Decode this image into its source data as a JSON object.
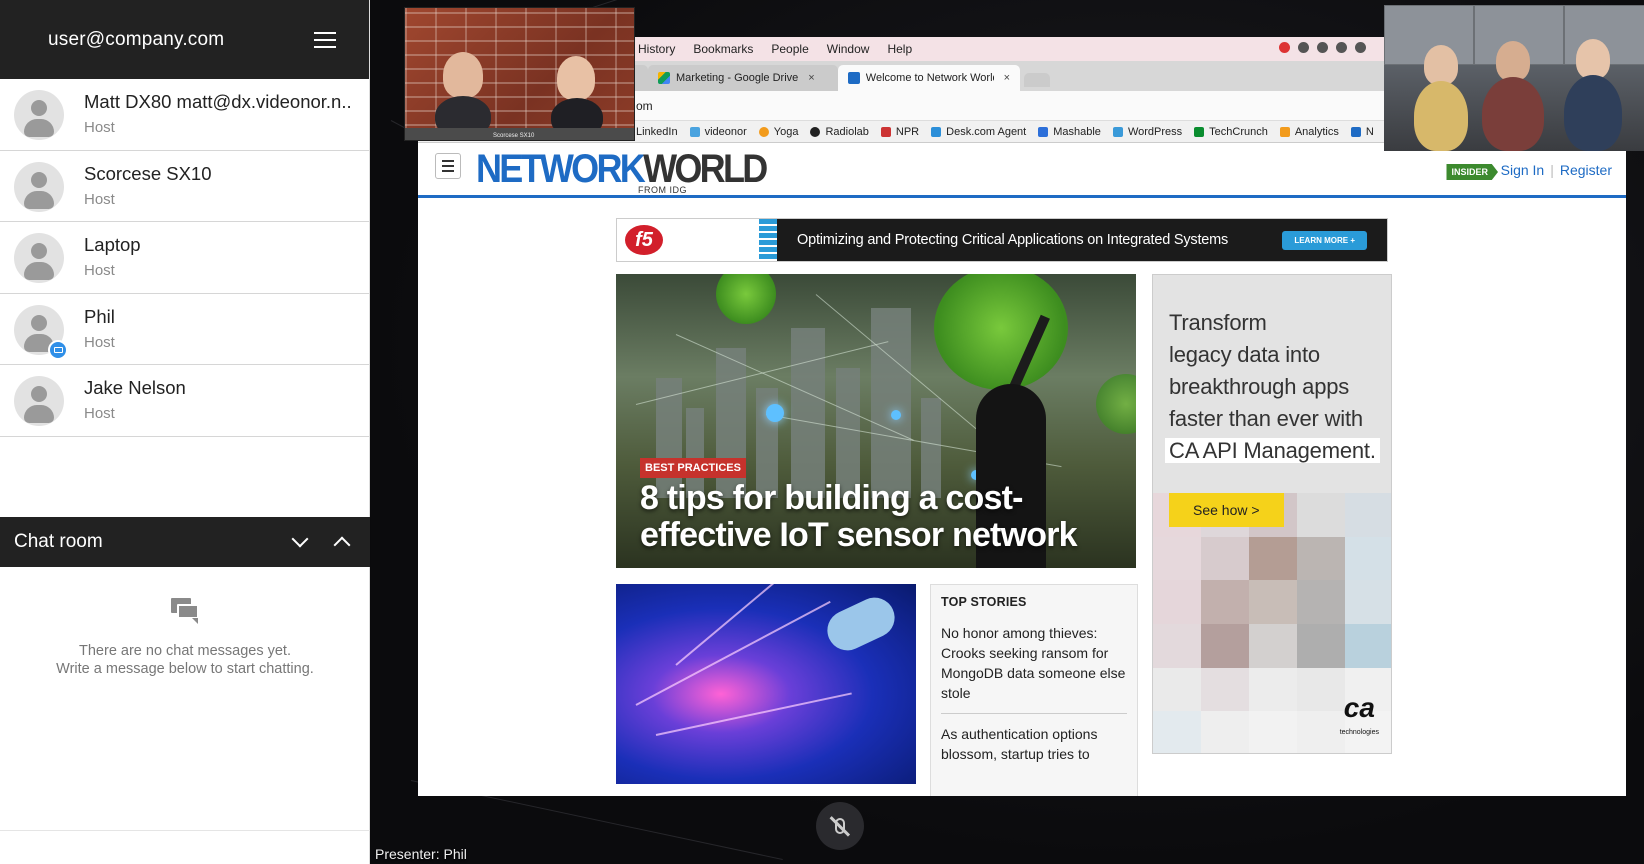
{
  "sidebar": {
    "user_email": "user@company.com",
    "participants": [
      {
        "name": "Matt DX80 matt@dx.videonor.n..",
        "role": "Host",
        "sharing": false
      },
      {
        "name": "Scorcese SX10",
        "role": "Host",
        "sharing": false
      },
      {
        "name": "Laptop",
        "role": "Host",
        "sharing": false
      },
      {
        "name": "Phil",
        "role": "Host",
        "sharing": true
      },
      {
        "name": "Jake Nelson",
        "role": "Host",
        "sharing": false
      }
    ],
    "chat": {
      "title": "Chat room",
      "empty_line1": "There are no chat messages yet.",
      "empty_line2": "Write a message below to start chatting."
    }
  },
  "stage": {
    "presenter_label": "Presenter: Phil",
    "video_tile_label": "Scorcese SX10",
    "mic_state": "muted"
  },
  "browser": {
    "menu": [
      "History",
      "Bookmarks",
      "People",
      "Window",
      "Help"
    ],
    "tabs": [
      {
        "label": "",
        "close": "×"
      },
      {
        "label": "Marketing - Google Drive",
        "close": "×"
      },
      {
        "label": "Welcome to Network World.cc",
        "close": "×"
      }
    ],
    "address_fragment": "om",
    "bookmarks": [
      "LinkedIn",
      "videonor",
      "Yoga",
      "Radiolab",
      "NPR",
      "Desk.com Agent",
      "Mashable",
      "WordPress",
      "TechCrunch",
      "Analytics",
      "N"
    ]
  },
  "website": {
    "logo_network": "NETWORK",
    "logo_world": "WORLD",
    "logo_from": "FROM IDG",
    "insider_badge": "INSIDER",
    "sign_in": "Sign In",
    "register": "Register",
    "banner": {
      "brand": "f5",
      "text": "Optimizing and Protecting Critical Applications on Integrated Systems",
      "cta": "LEARN MORE +"
    },
    "hero": {
      "tag": "BEST PRACTICES",
      "title": "8 tips for building a cost-effective IoT sensor network"
    },
    "side_ad": {
      "line1": "Transform",
      "line2": "legacy data into",
      "line3": "breakthrough apps",
      "line4": "faster than ever with",
      "line5": "CA API Management.",
      "cta": "See how >",
      "logo": "ca",
      "logo_sub": "technologies"
    },
    "top_stories": {
      "heading": "TOP STORIES",
      "items": [
        "No honor among thieves: Crooks seeking ransom for MongoDB data someone else stole",
        "As authentication options blossom, startup tries to"
      ]
    }
  },
  "colors": {
    "sidebar_header": "#222222",
    "network_world_blue": "#1e6bc4",
    "share_badge": "#2f8fe8",
    "hero_tag": "#c6322c",
    "see_how_button": "#f5d21a"
  }
}
